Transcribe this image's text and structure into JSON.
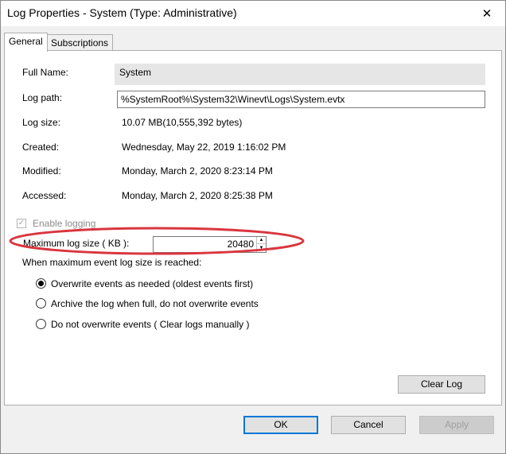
{
  "window": {
    "title": "Log Properties - System (Type: Administrative)",
    "close_glyph": "✕"
  },
  "tabs": [
    {
      "label": "General",
      "active": true
    },
    {
      "label": "Subscriptions",
      "active": false
    }
  ],
  "general": {
    "full_name_label": "Full Name:",
    "full_name_value": "System",
    "log_path_label": "Log path:",
    "log_path_value": "%SystemRoot%\\System32\\Winevt\\Logs\\System.evtx",
    "log_size_label": "Log size:",
    "log_size_value": "10.07 MB(10,555,392 bytes)",
    "created_label": "Created:",
    "created_value": "Wednesday, May 22, 2019 1:16:02 PM",
    "modified_label": "Modified:",
    "modified_value": "Monday, March 2, 2020 8:23:14 PM",
    "accessed_label": "Accessed:",
    "accessed_value": "Monday, March 2, 2020 8:25:38 PM",
    "enable_logging_label": "Enable logging",
    "enable_logging_checked": true,
    "max_size_label": "Maximum log size ( KB ):",
    "max_size_value": "20480",
    "policy_heading": "When maximum event log size is reached:",
    "policy_options": [
      {
        "label": "Overwrite events as needed (oldest events first)",
        "checked": true
      },
      {
        "label": "Archive the log when full, do not overwrite events",
        "checked": false
      },
      {
        "label": "Do not overwrite events ( Clear logs manually )",
        "checked": false
      }
    ],
    "clear_log_label": "Clear Log"
  },
  "footer": {
    "ok_label": "OK",
    "cancel_label": "Cancel",
    "apply_label": "Apply"
  },
  "colors": {
    "annotation_ellipse": "#d9363e",
    "default_button_border": "#0078d7"
  }
}
